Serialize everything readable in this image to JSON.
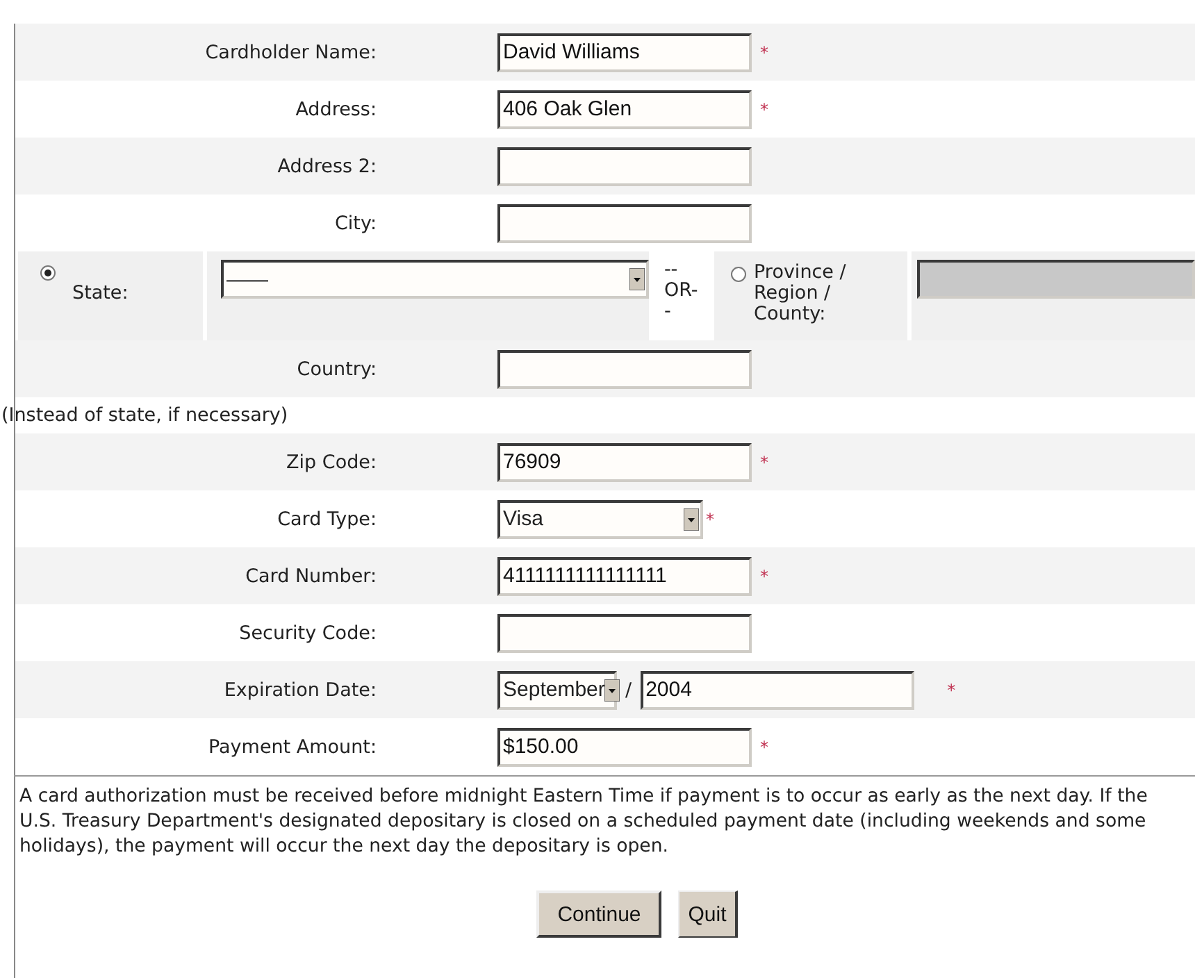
{
  "rows": [
    {
      "kind": "text",
      "label": "Cardholder Name:",
      "value": "David Williams",
      "required_marker": "*"
    },
    {
      "kind": "text",
      "label": "Address:",
      "value": "406 Oak Glen",
      "required_marker": "*"
    },
    {
      "kind": "text",
      "label": "Address 2:",
      "value": ""
    },
    {
      "kind": "text",
      "label": "City:",
      "value": ""
    },
    {
      "kind": "state",
      "label": "State:",
      "selected": true,
      "value": "——",
      "or_text": "-- OR- -",
      "province_label": "Province / Region / County:",
      "province_selected": false,
      "province_disabled": true
    },
    {
      "kind": "text",
      "label": "Country:",
      "value": ""
    },
    {
      "kind": "note",
      "text": "(Instead of state, if necessary)"
    },
    {
      "kind": "text",
      "label": "Zip Code:",
      "value": "76909",
      "required_marker": "*"
    },
    {
      "kind": "select",
      "label": "Card Type:",
      "value": "Visa",
      "required_marker": "*"
    },
    {
      "kind": "text",
      "label": "Card Number:",
      "value": "4111111111111111",
      "required_marker": "*"
    },
    {
      "kind": "text",
      "label": "Security Code:",
      "value": ""
    },
    {
      "kind": "expiry",
      "label": "Expiration Date:",
      "month": "September",
      "separator": "/",
      "year": "2004",
      "required_marker": "*"
    },
    {
      "kind": "text",
      "label": "Payment Amount:",
      "value": "$150.00",
      "required_marker": "*"
    }
  ],
  "notice": "A card authorization must be received before midnight Eastern Time if payment is to occur as early as the next day. If the U.S. Treasury Department's designated depositary is closed on a scheduled payment date (including weekends and some holidays), the payment will occur the next day the depositary is open.",
  "buttons": [
    {
      "label": "Continue",
      "kind": "primary"
    },
    {
      "label": "Quit",
      "kind": "secondary"
    }
  ]
}
